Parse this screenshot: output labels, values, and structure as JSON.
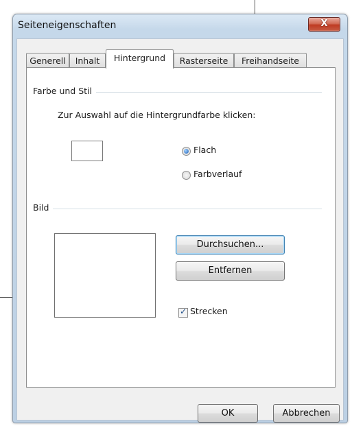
{
  "window": {
    "title": "Seiteneigenschaften",
    "close_glyph": "X"
  },
  "tabs": [
    {
      "label": "Generell",
      "active": false
    },
    {
      "label": "Inhalt",
      "active": false
    },
    {
      "label": "Hintergrund",
      "active": true
    },
    {
      "label": "Rasterseite",
      "active": false
    },
    {
      "label": "Freihandseite",
      "active": false
    }
  ],
  "color_section": {
    "group_label": "Farbe und Stil",
    "instruction": "Zur Auswahl auf die Hintergrundfarbe klicken:",
    "options": [
      {
        "label": "Flach",
        "selected": true
      },
      {
        "label": "Farbverlauf",
        "selected": false
      }
    ]
  },
  "image_section": {
    "group_label": "Bild",
    "browse_label": "Durchsuchen...",
    "remove_label": "Entfernen",
    "stretch_label": "Strecken",
    "stretch_checked": true
  },
  "footer": {
    "ok_label": "OK",
    "cancel_label": "Abbrechen"
  },
  "colors": {
    "accent": "#1f5fb3",
    "close": "#c65b43"
  }
}
